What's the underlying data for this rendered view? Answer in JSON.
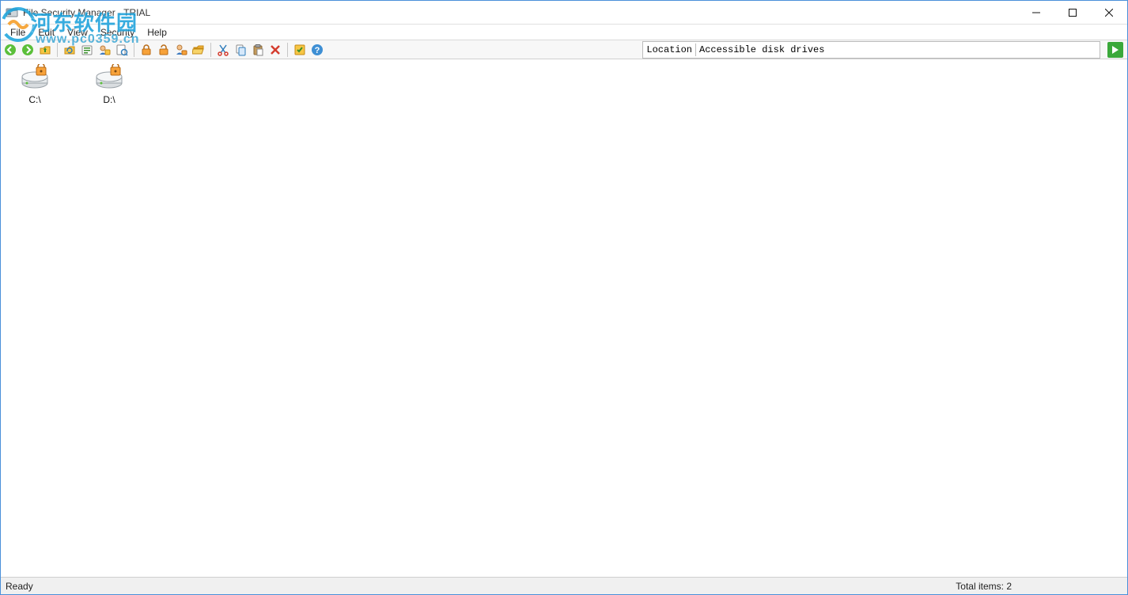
{
  "window": {
    "title": "File Security Manager - TRIAL"
  },
  "menu": {
    "items": [
      "File",
      "Edit",
      "View",
      "Security",
      "Help"
    ]
  },
  "toolbar": {
    "location_label": "Location",
    "location_value": "Accessible disk drives"
  },
  "content": {
    "drives": [
      {
        "label": "C:\\"
      },
      {
        "label": "D:\\"
      }
    ]
  },
  "statusbar": {
    "left": "Ready",
    "right": "Total items: 2"
  },
  "watermark": {
    "brand": "河东软件园",
    "url": "www.pc0359.cn"
  }
}
